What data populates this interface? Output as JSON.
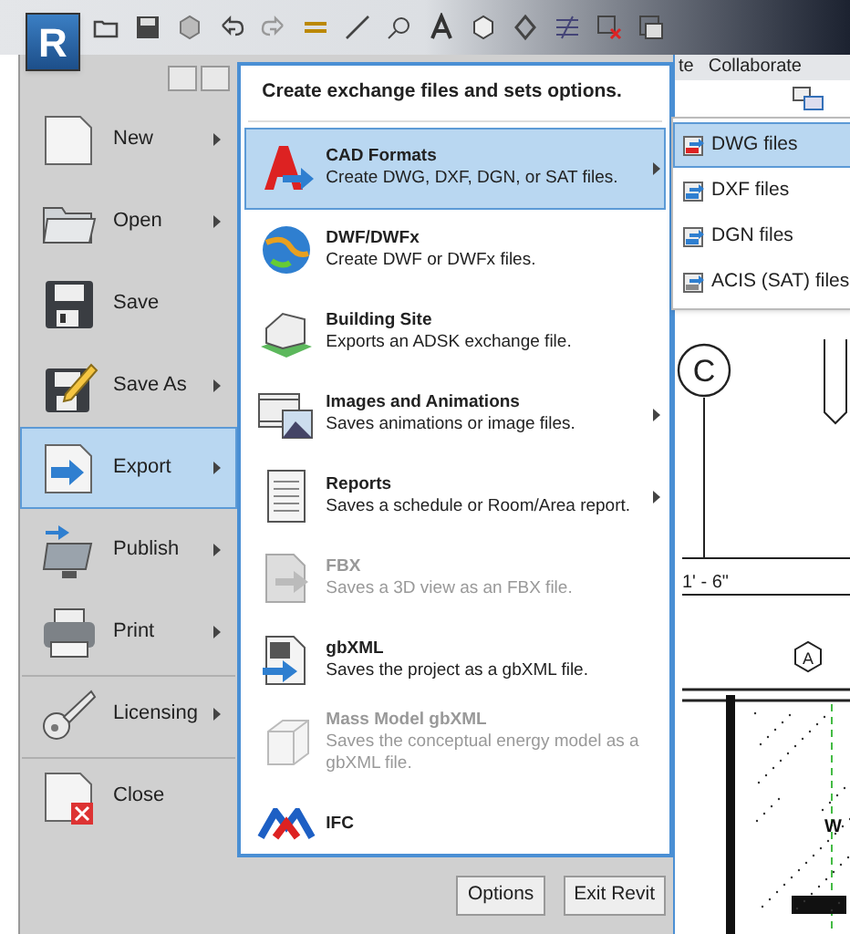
{
  "app_button": {
    "label": "R"
  },
  "ribbon_tabs": [
    {
      "label": "te"
    },
    {
      "label": "Collaborate"
    }
  ],
  "menu": [
    {
      "label": "New",
      "kind": "new",
      "has_submenu": true,
      "selected": false,
      "divider_before": false
    },
    {
      "label": "Open",
      "kind": "open",
      "has_submenu": true,
      "selected": false,
      "divider_before": false
    },
    {
      "label": "Save",
      "kind": "save",
      "has_submenu": false,
      "selected": false,
      "divider_before": false
    },
    {
      "label": "Save As",
      "kind": "saveas",
      "has_submenu": true,
      "selected": false,
      "divider_before": false
    },
    {
      "label": "Export",
      "kind": "export",
      "has_submenu": true,
      "selected": true,
      "divider_before": false
    },
    {
      "label": "Publish",
      "kind": "publish",
      "has_submenu": true,
      "selected": false,
      "divider_before": false
    },
    {
      "label": "Print",
      "kind": "print",
      "has_submenu": true,
      "selected": false,
      "divider_before": false
    },
    {
      "label": "Licensing",
      "kind": "licensing",
      "has_submenu": true,
      "selected": false,
      "divider_before": true
    },
    {
      "label": "Close",
      "kind": "close",
      "has_submenu": false,
      "selected": false,
      "divider_before": true
    }
  ],
  "export_panel": {
    "heading": "Create exchange files and sets options.",
    "items": [
      {
        "title": "CAD Formats",
        "description": "Create DWG, DXF, DGN, or SAT files.",
        "kind": "cad",
        "selected": true,
        "disabled": false,
        "has_submenu": true
      },
      {
        "title": "DWF/DWFx",
        "description": "Create DWF or DWFx files.",
        "kind": "dwf",
        "selected": false,
        "disabled": false,
        "has_submenu": false
      },
      {
        "title": "Building Site",
        "description": "Exports an ADSK exchange file.",
        "kind": "site",
        "selected": false,
        "disabled": false,
        "has_submenu": false
      },
      {
        "title": "Images and Animations",
        "description": "Saves animations or image files.",
        "kind": "images",
        "selected": false,
        "disabled": false,
        "has_submenu": true
      },
      {
        "title": "Reports",
        "description": "Saves a schedule or Room/Area report.",
        "kind": "reports",
        "selected": false,
        "disabled": false,
        "has_submenu": true
      },
      {
        "title": "FBX",
        "description": "Saves a 3D view as an FBX file.",
        "kind": "fbx",
        "selected": false,
        "disabled": true,
        "has_submenu": false
      },
      {
        "title": "gbXML",
        "description": "Saves the project as a gbXML file.",
        "kind": "gbxml",
        "selected": false,
        "disabled": false,
        "has_submenu": false
      },
      {
        "title": "Mass Model gbXML",
        "description": "Saves the conceptual energy model as a gbXML file.",
        "kind": "massgbxml",
        "selected": false,
        "disabled": true,
        "has_submenu": false
      },
      {
        "title": "IFC",
        "kind": "ifc",
        "selected": false,
        "disabled": false,
        "has_submenu": false
      }
    ]
  },
  "submenu": [
    {
      "label": "DWG files",
      "kind": "dwg",
      "selected": true
    },
    {
      "label": "DXF files",
      "kind": "dxf",
      "selected": false
    },
    {
      "label": "DGN files",
      "kind": "dgn",
      "selected": false
    },
    {
      "label": "ACIS (SAT) files",
      "kind": "sat",
      "selected": false
    }
  ],
  "buttons": [
    "Options",
    "Exit Revit"
  ],
  "drawing": {
    "grid_bubble": "C",
    "dimension": "1' - 6\"",
    "tag": "A",
    "edge_text": "W"
  }
}
